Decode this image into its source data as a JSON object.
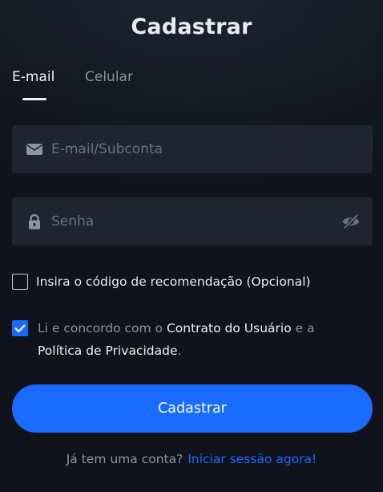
{
  "title": "Cadastrar",
  "tabs": [
    {
      "label": "E-mail",
      "active": true
    },
    {
      "label": "Celular",
      "active": false
    }
  ],
  "email_field": {
    "icon": "envelope-icon",
    "placeholder": "E-mail/Subconta",
    "value": ""
  },
  "password_field": {
    "icon": "lock-icon",
    "placeholder": "Senha",
    "value": "",
    "toggle_icon": "eye-slash-icon"
  },
  "referral": {
    "checked": false,
    "label": "Insira o código de recomendação (Opcional)"
  },
  "terms": {
    "checked": true,
    "prefix": "Li e concordo com o",
    "user_agreement": "Contrato do Usuário",
    "conjunction": "e a",
    "privacy_policy": "Política de Privacidade",
    "suffix": "."
  },
  "submit_label": "Cadastrar",
  "footer": {
    "question": "Já tem uma conta?",
    "login_link": "Iniciar sessão agora!"
  },
  "colors": {
    "background": "#131720",
    "field_background": "#1f2430",
    "accent": "#1a6bff",
    "muted_text": "#8c93a1",
    "primary_text": "#e8eaee"
  }
}
